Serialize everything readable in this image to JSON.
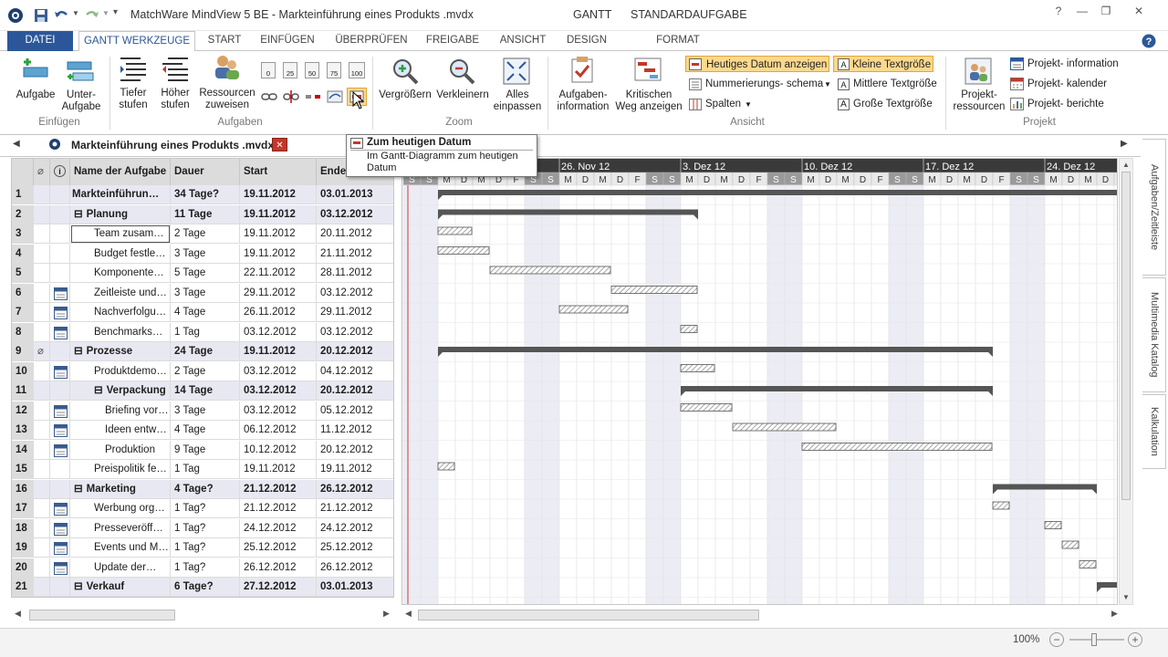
{
  "window": {
    "title": "MatchWare MindView 5 BE - Markteinführung eines Produkts .mvdx",
    "context_tab": "GANTT",
    "context_tab2": "STANDARDAUFGABE"
  },
  "tabs": [
    "DATEI",
    "GANTT WERKZEUGE",
    "START",
    "EINFÜGEN",
    "ÜBERPRÜFEN",
    "FREIGABE",
    "ANSICHT",
    "DESIGN",
    "FORMAT"
  ],
  "ribbon": {
    "einfuegen": {
      "label": "Einfügen",
      "aufgabe": "Aufgabe",
      "unter1": "Unter-",
      "unter2": "Aufgabe"
    },
    "aufgaben": {
      "label": "Aufgaben",
      "tiefer1": "Tiefer",
      "tiefer2": "stufen",
      "hoeher1": "Höher",
      "hoeher2": "stufen",
      "res1": "Ressourcen",
      "res2": "zuweisen",
      "pct": [
        "0",
        "25",
        "50",
        "75",
        "100"
      ]
    },
    "zoom": {
      "label": "Zoom",
      "groesser": "Vergrößern",
      "kleiner": "Verkleinern",
      "alles1": "Alles",
      "alles2": "einpassen"
    },
    "ansicht": {
      "label": "Ansicht",
      "info1": "Aufgaben-",
      "info2": "information",
      "krit1": "Kritischen",
      "krit2": "Weg anzeigen",
      "heute": "Heutiges Datum anzeigen",
      "num": "Nummerierungs- schema",
      "spalten": "Spalten",
      "klein": "Kleine Textgröße",
      "mittel": "Mittlere Textgröße",
      "gross": "Große Textgröße"
    },
    "projekt": {
      "label": "Projekt",
      "res1": "Projekt-",
      "res2": "ressourcen",
      "info": "Projekt- information",
      "kal": "Projekt- kalender",
      "ber": "Projekt- berichte"
    }
  },
  "doc_tab": "Markteinführung eines Produkts .mvdx*",
  "tooltip": {
    "title": "Zum heutigen Datum",
    "line1": "Im Gantt-Diagramm zum heutigen",
    "line2": "Datum"
  },
  "columns": {
    "name": "Name der Aufgabe",
    "dauer": "Dauer",
    "start": "Start",
    "ende": "Ende"
  },
  "rows": [
    {
      "n": "1",
      "name": "Markteinführun…",
      "dauer": "34 Tage?",
      "start": "19.11.2012",
      "ende": "03.01.2013",
      "level": 0,
      "summary": true
    },
    {
      "n": "2",
      "name": "Planung",
      "dauer": "11 Tage",
      "start": "19.11.2012",
      "ende": "03.12.2012",
      "level": 1,
      "summary": true
    },
    {
      "n": "3",
      "name": "Team  zusam…",
      "dauer": "2 Tage",
      "start": "19.11.2012",
      "ende": "20.11.2012",
      "level": 2
    },
    {
      "n": "4",
      "name": "Budget festle…",
      "dauer": "3 Tage",
      "start": "19.11.2012",
      "ende": "21.11.2012",
      "level": 2
    },
    {
      "n": "5",
      "name": "Komponente…",
      "dauer": "5 Tage",
      "start": "22.11.2012",
      "ende": "28.11.2012",
      "level": 2
    },
    {
      "n": "6",
      "name": "Zeitleiste und…",
      "dauer": "3 Tage",
      "start": "29.11.2012",
      "ende": "03.12.2012",
      "level": 2,
      "cal": true
    },
    {
      "n": "7",
      "name": "Nachverfolgu…",
      "dauer": "4 Tage",
      "start": "26.11.2012",
      "ende": "29.11.2012",
      "level": 2,
      "cal": true
    },
    {
      "n": "8",
      "name": "Benchmarks…",
      "dauer": "1 Tag",
      "start": "03.12.2012",
      "ende": "03.12.2012",
      "level": 2,
      "cal": true
    },
    {
      "n": "9",
      "name": "Prozesse",
      "dauer": "24 Tage",
      "start": "19.11.2012",
      "ende": "20.12.2012",
      "level": 1,
      "summary": true,
      "clip": true
    },
    {
      "n": "10",
      "name": "Produktdemo…",
      "dauer": "2 Tage",
      "start": "03.12.2012",
      "ende": "04.12.2012",
      "level": 2,
      "cal": true
    },
    {
      "n": "11",
      "name": "Verpackung",
      "dauer": "14 Tage",
      "start": "03.12.2012",
      "ende": "20.12.2012",
      "level": 2,
      "summary": true
    },
    {
      "n": "12",
      "name": "Briefing vor…",
      "dauer": "3 Tage",
      "start": "03.12.2012",
      "ende": "05.12.2012",
      "level": 3,
      "cal": true
    },
    {
      "n": "13",
      "name": "Ideen entw…",
      "dauer": "4 Tage",
      "start": "06.12.2012",
      "ende": "11.12.2012",
      "level": 3,
      "cal": true
    },
    {
      "n": "14",
      "name": "Produktion",
      "dauer": "9 Tage",
      "start": "10.12.2012",
      "ende": "20.12.2012",
      "level": 3,
      "cal": true
    },
    {
      "n": "15",
      "name": "Preispolitik fe…",
      "dauer": "1 Tag",
      "start": "19.11.2012",
      "ende": "19.11.2012",
      "level": 2
    },
    {
      "n": "16",
      "name": "Marketing",
      "dauer": "4 Tage?",
      "start": "21.12.2012",
      "ende": "26.12.2012",
      "level": 1,
      "summary": true
    },
    {
      "n": "17",
      "name": "Werbung org…",
      "dauer": "1 Tag?",
      "start": "21.12.2012",
      "ende": "21.12.2012",
      "level": 2,
      "cal": true
    },
    {
      "n": "18",
      "name": "Presseveröff…",
      "dauer": "1 Tag?",
      "start": "24.12.2012",
      "ende": "24.12.2012",
      "level": 2,
      "cal": true
    },
    {
      "n": "19",
      "name": "Events und M…",
      "dauer": "1 Tag?",
      "start": "25.12.2012",
      "ende": "25.12.2012",
      "level": 2,
      "cal": true
    },
    {
      "n": "20",
      "name": "Update der…",
      "dauer": "1 Tag?",
      "start": "26.12.2012",
      "ende": "26.12.2012",
      "level": 2,
      "cal": true
    },
    {
      "n": "21",
      "name": "Verkauf",
      "dauer": "6 Tage?",
      "start": "27.12.2012",
      "ende": "03.01.2013",
      "level": 1,
      "summary": true
    }
  ],
  "gantt": {
    "weeks": [
      "26. Nov 12",
      "3. Dez 12",
      "10. Dez 12",
      "17. Dez 12",
      "24. Dez 12"
    ],
    "days": [
      "S",
      "S",
      "M",
      "D",
      "M",
      "D",
      "F",
      "S",
      "S",
      "M",
      "D",
      "M",
      "D",
      "F",
      "S",
      "S",
      "M",
      "D",
      "M",
      "D",
      "F",
      "S",
      "S",
      "M",
      "D",
      "M",
      "D",
      "F",
      "S",
      "S",
      "M",
      "D",
      "M",
      "D",
      "F",
      "S",
      "S",
      "M",
      "D",
      "M",
      "D",
      "F"
    ]
  },
  "side_tabs": [
    "Aufgaben/Zeitleiste",
    "Multimedia Katalog",
    "Kalkulation"
  ],
  "status": {
    "zoom": "100%"
  },
  "colors": {
    "accent": "#2b579a",
    "highlight": "#fcd98d",
    "weekend": "#ececf4",
    "summary_bar": "#555555"
  }
}
